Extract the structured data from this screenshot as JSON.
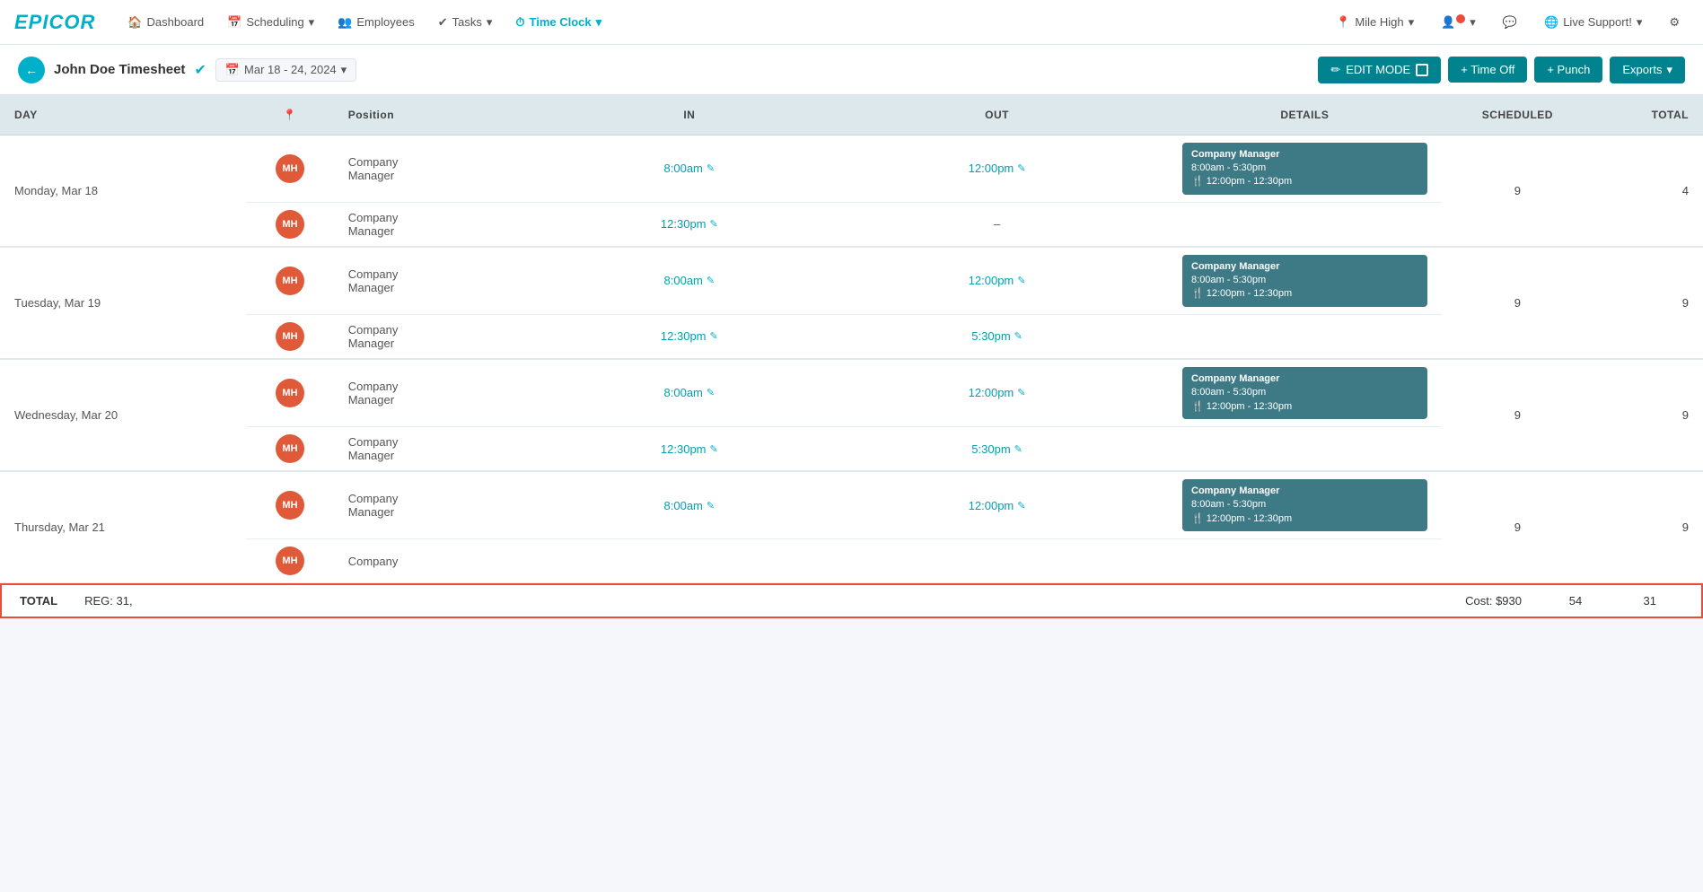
{
  "app": {
    "logo": "EPICOR"
  },
  "nav": {
    "items": [
      {
        "id": "dashboard",
        "icon": "🏠",
        "label": "Dashboard",
        "active": false,
        "has_dropdown": false
      },
      {
        "id": "scheduling",
        "icon": "📅",
        "label": "Scheduling",
        "active": false,
        "has_dropdown": true
      },
      {
        "id": "employees",
        "icon": "👥",
        "label": "Employees",
        "active": false,
        "has_dropdown": false
      },
      {
        "id": "tasks",
        "icon": "✔",
        "label": "Tasks",
        "active": false,
        "has_dropdown": true
      },
      {
        "id": "timeclock",
        "icon": "⏱",
        "label": "Time Clock",
        "active": true,
        "has_dropdown": true
      }
    ],
    "right": [
      {
        "id": "mile-high",
        "icon": "📍",
        "label": "Mile High",
        "has_dropdown": true
      },
      {
        "id": "user",
        "icon": "👤",
        "label": "",
        "has_dropdown": true,
        "has_dot": true
      },
      {
        "id": "chat",
        "icon": "💬",
        "label": "",
        "has_dropdown": false
      },
      {
        "id": "live-support",
        "icon": "🌐",
        "label": "Live Support!",
        "has_dropdown": true
      },
      {
        "id": "settings",
        "icon": "⚙",
        "label": "",
        "has_dropdown": false
      }
    ]
  },
  "header": {
    "back_label": "←",
    "title": "John Doe Timesheet",
    "check_icon": "✔",
    "date_icon": "📅",
    "date_range": "Mar 18 - 24, 2024",
    "date_dropdown": "▾",
    "edit_mode_label": "✏ EDIT MODE",
    "time_off_label": "+ Time Off",
    "punch_label": "+ Punch",
    "exports_label": "Exports",
    "exports_dropdown": "▾"
  },
  "table": {
    "columns": [
      {
        "id": "day",
        "label": "DAY"
      },
      {
        "id": "location",
        "label": "📍"
      },
      {
        "id": "position",
        "label": "Position"
      },
      {
        "id": "in",
        "label": "IN"
      },
      {
        "id": "out",
        "label": "OUT"
      },
      {
        "id": "details",
        "label": "DETAILS"
      },
      {
        "id": "scheduled",
        "label": "SCHEDULED"
      },
      {
        "id": "total",
        "label": "TOTAL"
      }
    ],
    "days": [
      {
        "day": "Monday, Mar 18",
        "entries": [
          {
            "badge": "MH",
            "position": "Company\nManager",
            "in_time": "8:00am",
            "out_time": "12:00pm",
            "show_details": true,
            "details": {
              "title": "Company Manager",
              "time": "8:00am - 5:30pm",
              "break": "12:00pm - 12:30pm"
            },
            "scheduled": "9",
            "total": "4"
          },
          {
            "badge": "MH",
            "position": "Company\nManager",
            "in_time": "12:30pm",
            "out_time": "–",
            "show_details": false,
            "details": null,
            "scheduled": "",
            "total": ""
          }
        ]
      },
      {
        "day": "Tuesday, Mar 19",
        "entries": [
          {
            "badge": "MH",
            "position": "Company\nManager",
            "in_time": "8:00am",
            "out_time": "12:00pm",
            "show_details": true,
            "details": {
              "title": "Company Manager",
              "time": "8:00am - 5:30pm",
              "break": "12:00pm - 12:30pm"
            },
            "scheduled": "9",
            "total": "9"
          },
          {
            "badge": "MH",
            "position": "Company\nManager",
            "in_time": "12:30pm",
            "out_time": "5:30pm",
            "show_details": false,
            "details": null,
            "scheduled": "",
            "total": ""
          }
        ]
      },
      {
        "day": "Wednesday, Mar 20",
        "entries": [
          {
            "badge": "MH",
            "position": "Company\nManager",
            "in_time": "8:00am",
            "out_time": "12:00pm",
            "show_details": true,
            "details": {
              "title": "Company Manager",
              "time": "8:00am - 5:30pm",
              "break": "12:00pm - 12:30pm"
            },
            "scheduled": "9",
            "total": "9"
          },
          {
            "badge": "MH",
            "position": "Company\nManager",
            "in_time": "12:30pm",
            "out_time": "5:30pm",
            "show_details": false,
            "details": null,
            "scheduled": "",
            "total": ""
          }
        ]
      },
      {
        "day": "Thursday, Mar 21",
        "entries": [
          {
            "badge": "MH",
            "position": "Company\nManager",
            "in_time": "8:00am",
            "out_time": "12:00pm",
            "show_details": true,
            "details": {
              "title": "Company Manager",
              "time": "8:00am - 5:30pm",
              "break": "12:00pm - 12:30pm"
            },
            "scheduled": "9",
            "total": "9"
          },
          {
            "badge": "MH",
            "position": "Company",
            "in_time": "",
            "out_time": "",
            "show_details": false,
            "details": null,
            "scheduled": "",
            "total": ""
          }
        ]
      }
    ]
  },
  "totals": {
    "label": "TOTAL",
    "reg": "REG: 31,",
    "cost": "Cost: $930",
    "scheduled": "54",
    "total": "31"
  }
}
